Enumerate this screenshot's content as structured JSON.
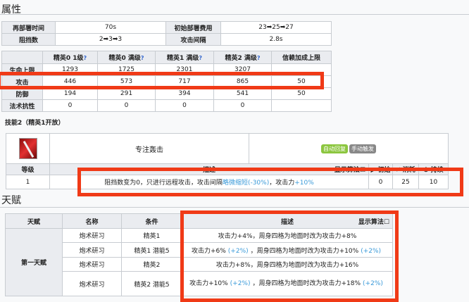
{
  "attributes": {
    "title": "属性",
    "basic": [
      [
        "再部署时间",
        "70s",
        "初始部署费用",
        "23➡25➡27"
      ],
      [
        "阻挡数",
        "2➡3➡3",
        "攻击间隔",
        "2.8s"
      ]
    ],
    "stats_headers": [
      "",
      "精英0 1级",
      "精英0 满级",
      "精英1 满级",
      "精英2 满级",
      "信赖加成上限"
    ],
    "help_icon": "?",
    "stats_rows": [
      [
        "生命上限",
        "1293",
        "1725",
        "2301",
        "3207",
        ""
      ],
      [
        "攻击",
        "446",
        "573",
        "717",
        "865",
        "50"
      ],
      [
        "防御",
        "194",
        "291",
        "394",
        "541",
        "50"
      ],
      [
        "法术抗性",
        "0",
        "0",
        "0",
        "0",
        ""
      ]
    ]
  },
  "skill": {
    "title": "技能2（精英1开放）",
    "name": "专注轰击",
    "tags": [
      "自动回复",
      "手动触发"
    ],
    "tag_colors": [
      "#8cc63f",
      "#888888"
    ],
    "headers": [
      "等级",
      "描述",
      "显示算法",
      "▶ 初始",
      "⚡ 消耗",
      "⏱ 持续"
    ],
    "row": {
      "level": "1",
      "desc_a": "阻挡数变为0，只进行远程攻击，攻击间隔",
      "desc_b": "略微缩短(-30%)",
      "desc_c": "，攻击力",
      "desc_d": "+10%",
      "initial": "0",
      "cost": "25",
      "duration": "10"
    }
  },
  "talent": {
    "title": "天赋",
    "headers": [
      "天赋",
      "名称",
      "条件",
      "描述",
      "显示算法"
    ],
    "group": "第一天赋",
    "rows": [
      {
        "name": "炮术研习",
        "cond": "精英1",
        "a": "攻击力+4%，周身四格为地面时改为攻击力+8%",
        "b": "",
        "c": "",
        "d": ""
      },
      {
        "name": "炮术研习",
        "cond": "精英1 潜能5",
        "a": "攻击力+6%",
        "b": "(+2%)",
        "c": "，周身四格为地面时改为攻击力+10%",
        "d": "(+2%)"
      },
      {
        "name": "炮术研习",
        "cond": "精英2",
        "a": "攻击力+8%，周身四格为地面时改为攻击力+16%",
        "b": "",
        "c": "",
        "d": ""
      },
      {
        "name": "炮术研习",
        "cond": "精英2 潜能5",
        "a": "攻击力+10%",
        "b": "(+2%)",
        "c": "，周身四格为地面时改为攻击力+18%",
        "d": "(+2%)"
      }
    ]
  }
}
